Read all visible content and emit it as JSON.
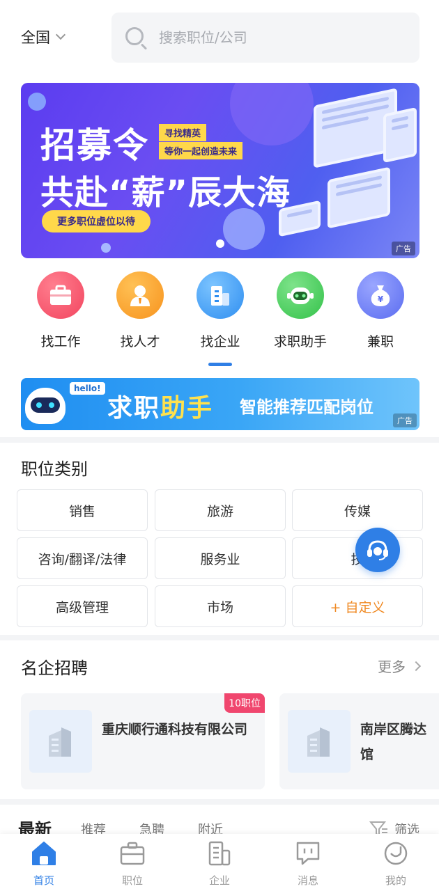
{
  "header": {
    "city": "全国",
    "search_placeholder": "搜索职位/公司"
  },
  "banner": {
    "line1": "招募令",
    "line2": "共赴“薪”辰大海",
    "tag1": "寻找精英",
    "tag2": "等你一起创造未来",
    "pill": "更多职位虚位以待",
    "ad": "广告"
  },
  "icon_nav": [
    {
      "label": "找工作",
      "icon": "briefcase-icon",
      "color": "#f2455f"
    },
    {
      "label": "找人才",
      "icon": "person-icon",
      "color": "#f7931e"
    },
    {
      "label": "找企业",
      "icon": "building-icon",
      "color": "#2f8ef0"
    },
    {
      "label": "求职助手",
      "icon": "robot-icon",
      "color": "#34c24a"
    },
    {
      "label": "兼职",
      "icon": "money-bag-icon",
      "color": "#5a6cf0"
    }
  ],
  "helper_banner": {
    "hello": "hello!",
    "title_a": "求职",
    "title_b": "助手",
    "subtitle": "智能推荐匹配岗位",
    "ad": "广告"
  },
  "categories": {
    "title": "职位类别",
    "items": [
      "销售",
      "旅游",
      "传媒",
      "咨询/翻译/法律",
      "服务业",
      "技",
      "高级管理",
      "市场",
      "+ 自定义"
    ]
  },
  "companies": {
    "title": "名企招聘",
    "more": "更多",
    "items": [
      {
        "name": "重庆顺行通科技有限公司",
        "badge": "10职位"
      },
      {
        "name": "南岸区腾达馆",
        "badge": ""
      }
    ]
  },
  "feed_tabs": {
    "tabs": [
      "最新",
      "推荐",
      "急聘",
      "附近"
    ],
    "filter": "筛选"
  },
  "bottom_nav": [
    {
      "label": "首页",
      "icon": "home-icon",
      "active": true
    },
    {
      "label": "职位",
      "icon": "briefcase-icon",
      "active": false
    },
    {
      "label": "企业",
      "icon": "building-icon",
      "active": false
    },
    {
      "label": "消息",
      "icon": "message-icon",
      "active": false
    },
    {
      "label": "我的",
      "icon": "profile-icon",
      "active": false
    }
  ],
  "colors": {
    "primary": "#2f7fe6",
    "accent_orange": "#f08a24",
    "badge_pink": "#f0466e"
  }
}
